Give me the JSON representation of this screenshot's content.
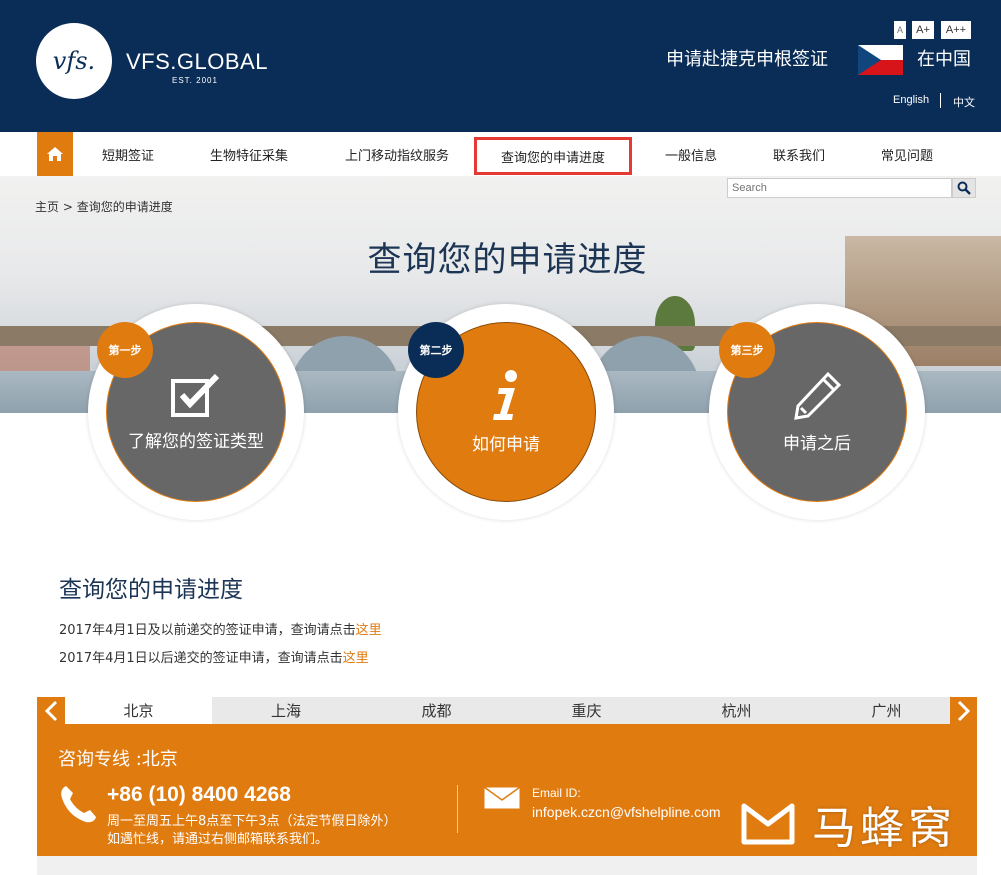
{
  "header": {
    "logo_text": "vfs.",
    "brand": "VFS.GLOBAL",
    "brand_sub": "EST. 2001",
    "font_small": "A",
    "font_medium": "A+",
    "font_large": "A++",
    "apply_title": "申请赴捷克申根签证",
    "country_label": "在中国",
    "lang_en": "English",
    "lang_cn": "中文"
  },
  "nav": {
    "items": [
      {
        "label": "短期签证"
      },
      {
        "label": "生物特征采集"
      },
      {
        "label": "上门移动指纹服务"
      },
      {
        "label": "查询您的申请进度"
      },
      {
        "label": "一般信息"
      },
      {
        "label": "联系我们"
      },
      {
        "label": "常见问题"
      }
    ]
  },
  "search": {
    "placeholder": "Search"
  },
  "breadcrumb": {
    "home": "主页",
    "separator": " > ",
    "current": "查询您的申请进度"
  },
  "hero": {
    "title": "查询您的申请进度"
  },
  "steps": [
    {
      "badge": "第一步",
      "label": "了解您的签证类型",
      "icon": "checkbox-icon"
    },
    {
      "badge": "第二步",
      "label": "如何申请",
      "icon": "info-icon"
    },
    {
      "badge": "第三步",
      "label": "申请之后",
      "icon": "pencil-icon"
    }
  ],
  "content": {
    "title": "查询您的申请进度",
    "line1_text": "2017年4月1日及以前递交的签证申请，查询请点击",
    "line1_link": "这里",
    "line2_text": "2017年4月1日以后递交的签证申请，查询请点击",
    "line2_link": "这里"
  },
  "city_tabs": [
    {
      "label": "北京"
    },
    {
      "label": "上海"
    },
    {
      "label": "成都"
    },
    {
      "label": "重庆"
    },
    {
      "label": "杭州"
    },
    {
      "label": "广州"
    }
  ],
  "contact": {
    "title": "咨询专线 :北京",
    "phone": "+86 (10) 8400 4268",
    "hours": "周一至周五上午8点至下午3点（法定节假日除外）",
    "note": "如遇忙线，请通过右侧邮箱联系我们。",
    "email_label": "Email ID:",
    "email": "infopek.czcn@vfshelpline.com"
  },
  "watermark": {
    "text": "马蜂窝"
  },
  "colors": {
    "navy": "#0a2d57",
    "orange": "#e07b10",
    "gray_circle": "#676767",
    "active_outline": "#e53935"
  }
}
